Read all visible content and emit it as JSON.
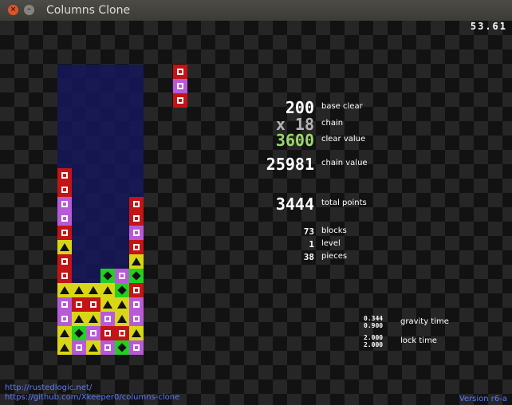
{
  "window": {
    "title": "Columns Clone"
  },
  "fps": "53.61",
  "stats": {
    "base_clear": {
      "value": "200",
      "label": "base clear"
    },
    "chain": {
      "value": "x 18",
      "label": "chain"
    },
    "clear_value": {
      "value": "3600",
      "label": "clear value"
    },
    "chain_value": {
      "value": "25981",
      "label": "chain value"
    },
    "total_points": {
      "value": "3444",
      "label": "total points"
    },
    "blocks": {
      "value": "73",
      "label": "blocks"
    },
    "level": {
      "value": "1",
      "label": "level"
    },
    "pieces": {
      "value": "38",
      "label": "pieces"
    }
  },
  "timers": {
    "gravity": {
      "value": "0.344\n0.900",
      "label": "gravity time"
    },
    "lock": {
      "value": "2.000\n2.000",
      "label": "lock time"
    }
  },
  "links": {
    "site": "http://rustedlogic.net/",
    "github": "https://github.com/Xkeeper0/columns-clone"
  },
  "version": "Version r6-a",
  "colors": {
    "red": "#c41416",
    "purple": "#b85ad8",
    "yellow": "#d8d616",
    "green": "#22d022",
    "clear_value_text": "#9bd96b",
    "chain_text": "#b4b4b4",
    "link_text": "#5b7cff"
  },
  "next_piece": [
    "red",
    "purple",
    "red"
  ],
  "board": [
    "......",
    "......",
    "......",
    "......",
    "......",
    "......",
    "......",
    "......",
    "r.....",
    "r.....",
    "p....r",
    "p....r",
    "r....p",
    "y....r",
    "r....y",
    "r..gpg",
    "yyyygr",
    "prryyp",
    "pyypyp",
    "ygprry",
    "ypypgp"
  ]
}
